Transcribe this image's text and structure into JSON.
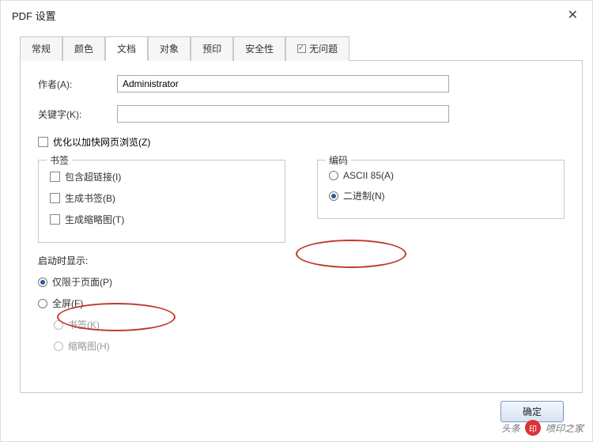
{
  "title": "PDF 设置",
  "tabs": {
    "general": "常规",
    "color": "颜色",
    "document": "文档",
    "object": "对象",
    "preview": "预印",
    "security": "安全性",
    "noissue": "无问题"
  },
  "fields": {
    "author_label": "作者(A):",
    "author_value": "Administrator",
    "keywords_label": "关键字(K):",
    "keywords_value": ""
  },
  "optimize_label": "优化以加快网页浏览(Z)",
  "groups": {
    "bookmarks": {
      "legend": "书签",
      "include_links": "包含超链接(I)",
      "gen_bookmarks": "生成书签(B)",
      "gen_thumbs": "生成缩略图(T)"
    },
    "encoding": {
      "legend": "编码",
      "ascii": "ASCII 85(A)",
      "binary": "二进制(N)"
    },
    "startup": {
      "legend": "启动时显示:",
      "page_only": "仅限于页面(P)",
      "fullscreen": "全屏(F)",
      "bookmarks": "书签(K)",
      "thumbnails": "缩略图(H)"
    }
  },
  "footer": {
    "ok": "确定"
  },
  "watermark": {
    "brand_prefix": "头条",
    "brand": "喷印之家"
  }
}
